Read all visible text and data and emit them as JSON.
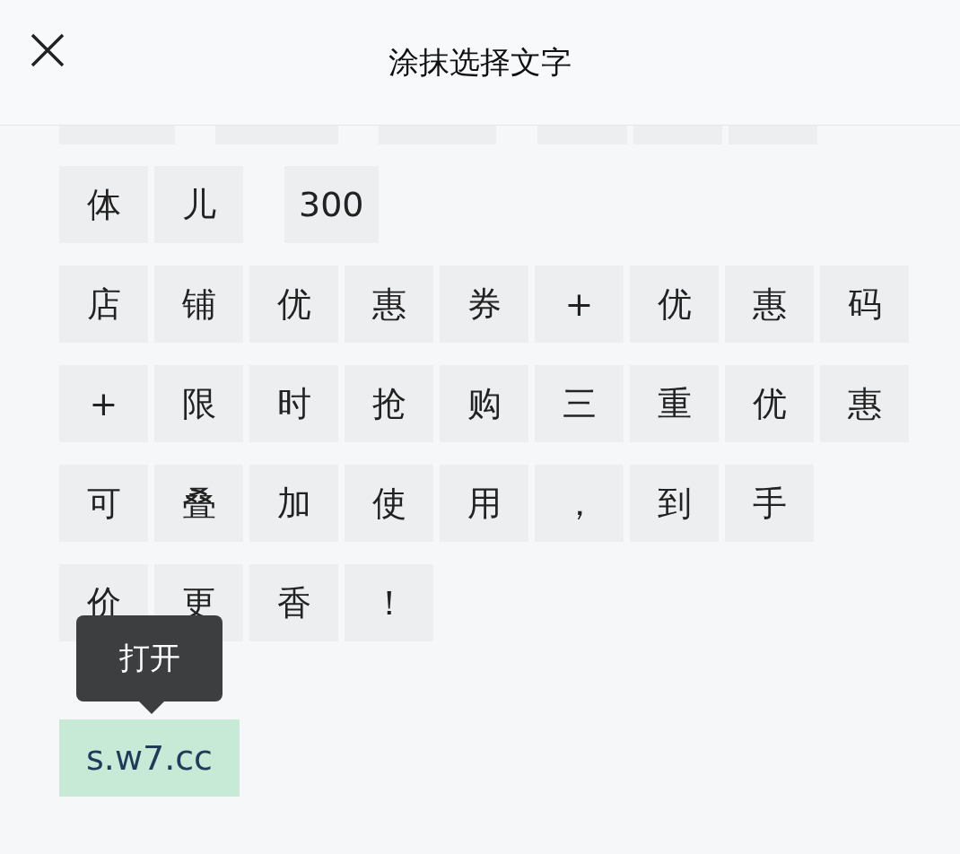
{
  "header": {
    "title": "涂抹选择文字"
  },
  "rows": [
    {
      "words": [
        [
          "体",
          "儿"
        ],
        [
          "300"
        ]
      ]
    },
    {
      "words": [
        [
          "店",
          "铺",
          "优",
          "惠",
          "券",
          "+",
          "优",
          "惠",
          "码"
        ]
      ]
    },
    {
      "words": [
        [
          "+",
          "限",
          "时",
          "抢",
          "购",
          "三",
          "重",
          "优",
          "惠"
        ]
      ]
    },
    {
      "words": [
        [
          "可",
          "叠",
          "加",
          "使",
          "用",
          "，",
          "到",
          "手"
        ]
      ]
    },
    {
      "words": [
        [
          "价",
          "更",
          "香",
          "！"
        ]
      ]
    }
  ],
  "link": {
    "text": "s.w7.cc",
    "selected": true
  },
  "tooltip": {
    "text": "打开"
  }
}
